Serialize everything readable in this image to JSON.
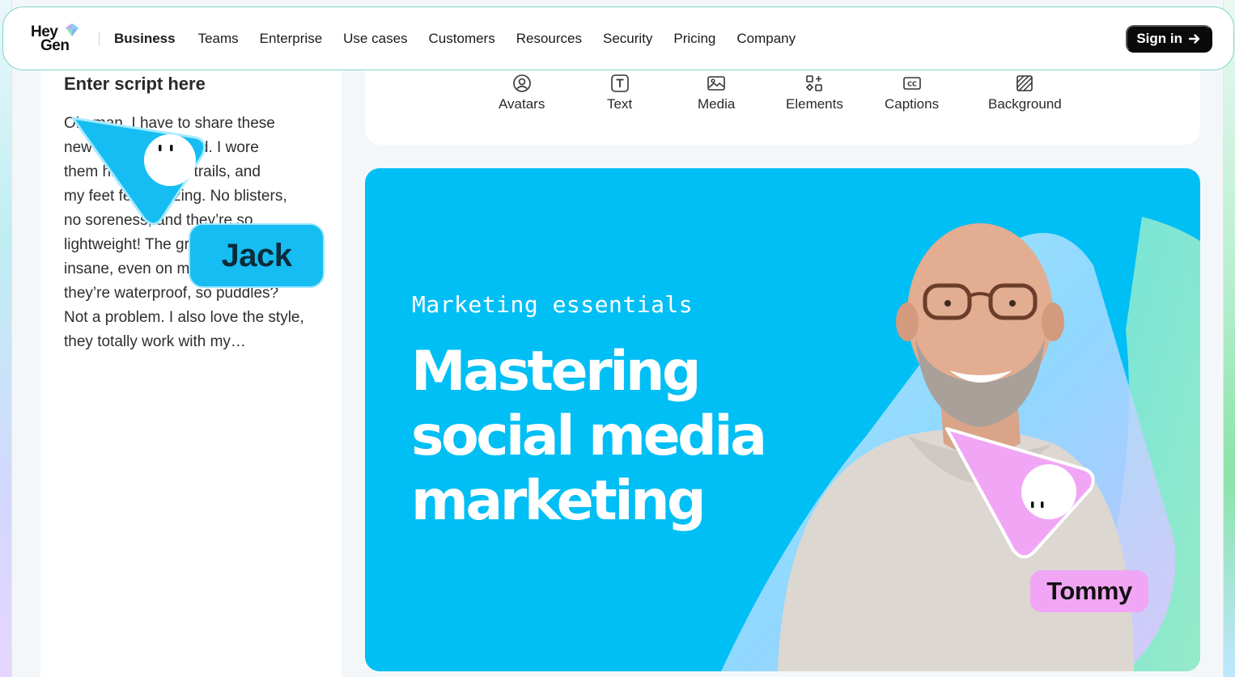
{
  "brand": {
    "logo_line1": "Hey",
    "logo_line2": "Gen"
  },
  "nav": {
    "links": [
      "Business",
      "Teams",
      "Enterprise",
      "Use cases",
      "Customers",
      "Resources",
      "Security",
      "Pricing",
      "Company"
    ],
    "active": "Business",
    "signin_label": "Sign in"
  },
  "script_panel": {
    "title": "Enter script here",
    "lines": [
      "Oh, man, I have to share these",
      "new shoes I just tried. I wore",
      "them hiking on the trails, and",
      "my feet felt amazing. No blisters,",
      "no soreness, and they’re so",
      "lightweight! The grip is",
      "insane, even on muddy paths, and",
      "they’re waterproof, so puddles?",
      "Not a problem. I also love the style,",
      "they totally work with my…"
    ]
  },
  "toolbar": {
    "tools": [
      {
        "label": "Avatars",
        "icon": "avatar-icon"
      },
      {
        "label": "Text",
        "icon": "text-icon"
      },
      {
        "label": "Media",
        "icon": "media-icon"
      },
      {
        "label": "Elements",
        "icon": "elements-icon"
      },
      {
        "label": "Captions",
        "icon": "captions-icon"
      },
      {
        "label": "Background",
        "icon": "background-icon"
      }
    ]
  },
  "canvas": {
    "subtitle": "Marketing essentials",
    "headline_lines": [
      "Mastering",
      "social media",
      "marketing"
    ]
  },
  "collaborators": {
    "jack": {
      "name": "Jack",
      "color": "#16bdf2"
    },
    "tommy": {
      "name": "Tommy",
      "color": "#f0a6f5"
    }
  },
  "colors": {
    "accent": "#00bff5",
    "nav_border": "#7fd6c7",
    "signin_bg": "#0a0a0a"
  }
}
